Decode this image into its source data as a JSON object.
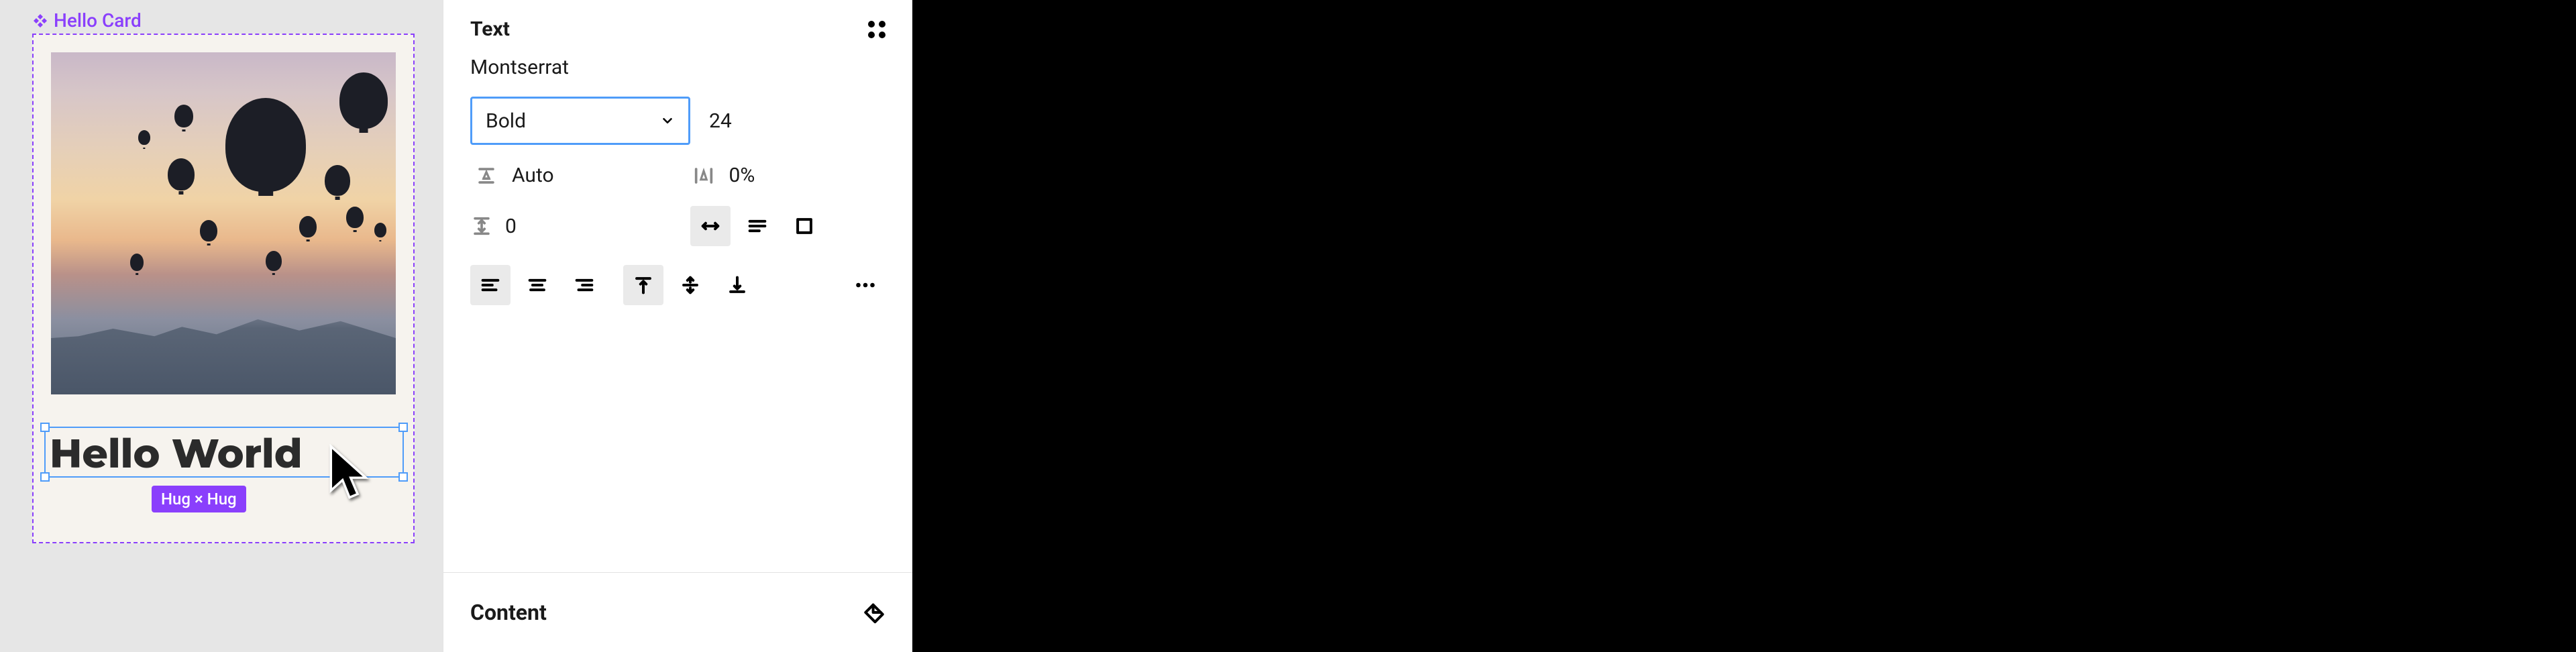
{
  "canvas": {
    "component_label": "Hello Card",
    "text_value": "Hello World",
    "size_badge": "Hug × Hug"
  },
  "text_panel": {
    "title": "Text",
    "font_family": "Montserrat",
    "font_weight": "Bold",
    "font_size": "24",
    "line_height_label": "Auto",
    "letter_spacing": "0%",
    "paragraph_spacing": "0",
    "content_section": "Content"
  }
}
